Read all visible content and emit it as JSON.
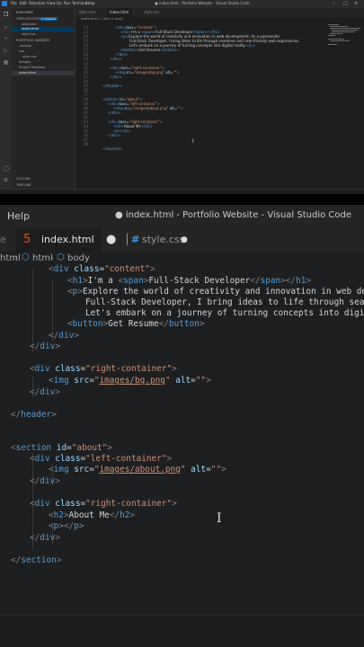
{
  "top": {
    "menu": [
      "File",
      "Edit",
      "Selection",
      "View",
      "Go",
      "Run",
      "Terminal",
      "Help"
    ],
    "window_title": "● index.html - Portfolio Website - Visual Studio Code",
    "sidebar": {
      "explorer_title": "EXPLORER",
      "open_editors": "OPEN EDITORS",
      "open_editors_badge": "1 unsaved",
      "open_items": [
        "Welcome",
        "index.html",
        "style.css"
      ],
      "project_title": "PORTFOLIO WEBSITE",
      "tree": [
        ".vscode",
        "css",
        "style.css",
        "images",
        "Project Previews",
        "index.html"
      ],
      "outline": "OUTLINE",
      "timeline": "TIMELINE"
    },
    "tabs": [
      "Welcome",
      "index.html",
      "style.css"
    ],
    "breadcrumb": "index.html > html > body"
  },
  "zoom": {
    "help": "Help",
    "window_title": "● index.html - Portfolio Website - Visual Studio Code",
    "tab_active": "index.html",
    "tab_other": "style.css",
    "breadcrumb_file": "html",
    "breadcrumb_tag1": "html",
    "breadcrumb_tag2": "body",
    "cursor": "I"
  },
  "code": [
    "<div class=\"content\">",
    "<h1>I'm a <span>Full-Stack Developer</span></h1>",
    "<p>Explore the world of creativity and innovation in web development. As a passionate",
    "Full-Stack Developer, I bring ideas to life through seamless and user-friendly web experiences.",
    "Let's embark on a journey of turning concepts into digital reality.</p>",
    "<button>Get Resume</button>",
    "</div>",
    "</div>",
    "<div class=\"right-container\">",
    "<img src=\"images/bg.png\" alt=\"\">",
    "</div>",
    "</header>",
    "<section id=\"about\">",
    "<div class=\"left-container\">",
    "<img src=\"images/about.png\" alt=\"\">",
    "</div>",
    "<div class=\"right-container\">",
    "<h2>About Me</h2>",
    "<p></p>",
    "</div>",
    "</section>"
  ],
  "line_numbers": [
    "22",
    "23",
    "24",
    "25",
    "26",
    "27",
    "28",
    "29",
    "30",
    "31",
    "32",
    "33",
    "34",
    "35",
    "36",
    "37",
    "38",
    "39",
    "40",
    "41",
    "42",
    "43",
    "44",
    "45",
    "46",
    "47",
    "48"
  ]
}
